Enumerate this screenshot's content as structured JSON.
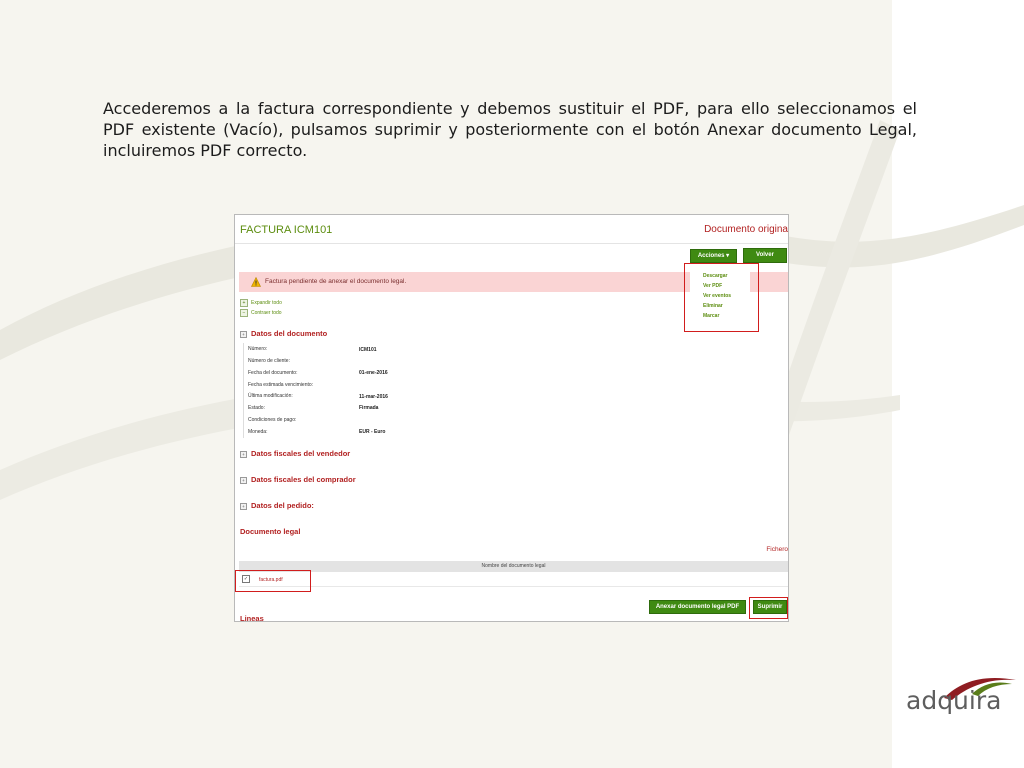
{
  "slide": {
    "intro_text": "Accederemos a la factura correspondiente y debemos sustituir el PDF, para ello seleccionamos el PDF existente (Vacío), pulsamos suprimir y posteriormente con el botón Anexar documento Legal, incluiremos PDF correcto."
  },
  "invoice": {
    "title": "FACTURA ICM101",
    "doc_original": "Documento origina",
    "acciones_label": "Acciones ▾",
    "volver_label": "Volver",
    "actions_menu": [
      "Descargar",
      "Ver PDF",
      "Ver eventos",
      "Eliminar",
      "Marcar"
    ],
    "alert_text": "Factura pendiente de anexar el documento legal.",
    "expand_all": "Expandir todo",
    "collapse_all": "Contraer todo",
    "sections": {
      "datos_documento": "Datos del documento",
      "datos_vendedor": "Datos fiscales del vendedor",
      "datos_comprador": "Datos fiscales del comprador",
      "datos_pedido": "Datos del pedido:"
    },
    "fields": [
      {
        "label": "Número:",
        "value": "ICM101"
      },
      {
        "label": "Número de cliente:",
        "value": ""
      },
      {
        "label": "Fecha del documento:",
        "value": "01-ene-2016"
      },
      {
        "label": "Fecha estimada vencimiento:",
        "value": ""
      },
      {
        "label": "Última modificación:",
        "value": "11-mar-2016"
      },
      {
        "label": "Estado:",
        "value": "Firmada"
      },
      {
        "label": "Condiciones de pago:",
        "value": ""
      },
      {
        "label": "Moneda:",
        "value": "EUR - Euro"
      }
    ],
    "legal": {
      "heading": "Documento legal",
      "ficheros": "Fichero",
      "column_header": "Nombre del documento legal",
      "file_name": "factura.pdf",
      "checkbox_mark": "✓",
      "anexar_label": "Anexar documento legal PDF",
      "suprimir_label": "Suprimir"
    },
    "lineas": "Lineas"
  },
  "brand": {
    "logo_text": "adquira",
    "accent_green": "#3f8a12",
    "accent_red": "#b22222",
    "highlight_red": "#d11d1d"
  },
  "icons": [
    "warning-icon",
    "plus-icon",
    "minus-icon",
    "checkbox-icon",
    "logo-mark-icon"
  ]
}
